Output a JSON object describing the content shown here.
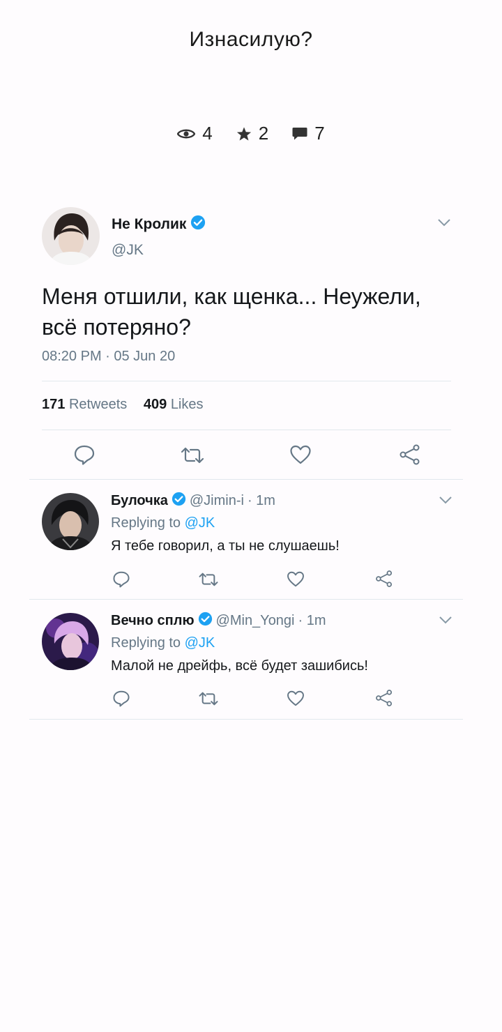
{
  "story": {
    "title": "Изнасилую?",
    "stats": {
      "views": "4",
      "stars": "2",
      "comments": "7"
    }
  },
  "tweet": {
    "author_name": "Не Кролик",
    "handle": "@JK",
    "text": "Меня отшили, как щенка... Неужели, всё потеряно?",
    "timestamp": "08:20 PM · 05 Jun 20",
    "retweets_count": "171",
    "retweets_label": "Retweets",
    "likes_count": "409",
    "likes_label": "Likes"
  },
  "replies": [
    {
      "name": "Булочка",
      "handle": "@Jimin-i",
      "time": "· 1m",
      "replying_prefix": "Replying to",
      "replying_to": "@JK",
      "text": "Я тебе говорил, а ты не слушаешь!"
    },
    {
      "name": "Вечно сплю",
      "handle": "@Min_Yongi",
      "time": "· 1m",
      "replying_prefix": "Replying to",
      "replying_to": "@JK",
      "text": "Малой не дрейфь, всё будет зашибись!"
    }
  ],
  "colors": {
    "verified": "#1da1f2",
    "secondary_text": "#657786",
    "divider": "#e1e8ed"
  },
  "icons": [
    "eye-icon",
    "star-icon",
    "comment-icon",
    "verified-icon",
    "chevron-down-icon",
    "reply-icon",
    "retweet-icon",
    "like-icon",
    "share-icon"
  ]
}
